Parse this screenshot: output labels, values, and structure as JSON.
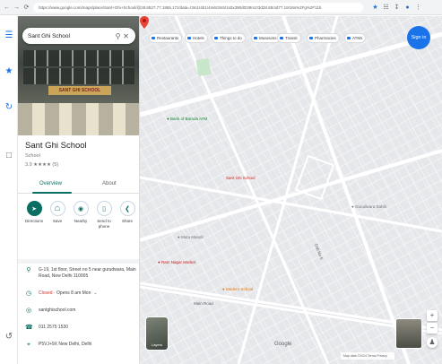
{
  "browser": {
    "url": "https://www.google.com/maps/place/Sant+Ghi+School/@28.6527,77.1955,17z/data=!3m1!4b1!4m6!3m5!1s0x390d03!8m2!3d28.65!4d77.19!16s%2Fg%2F11b",
    "icons": [
      "back-icon",
      "forward-icon",
      "reload-icon",
      "bookmark-icon",
      "extensions-icon",
      "profile-icon",
      "menu-icon"
    ]
  },
  "search": {
    "query": "Sant Ghi School"
  },
  "place": {
    "hero_sign": "SANT GHI SCHOOL",
    "name": "Sant Ghi School",
    "category": "School",
    "rating_text": "3.9 ★★★★ (5)",
    "tabs": [
      {
        "label": "Overview"
      },
      {
        "label": "About"
      }
    ],
    "actions": [
      {
        "label": "Directions",
        "icon": "directions-icon"
      },
      {
        "label": "Save",
        "icon": "bookmark-icon"
      },
      {
        "label": "Nearby",
        "icon": "nearby-icon"
      },
      {
        "label": "Send to phone",
        "icon": "phone-icon"
      },
      {
        "label": "Share",
        "icon": "share-icon"
      }
    ],
    "info": {
      "address": "G-19, 1st floor, Street no 5 near gurudwara, Main Road, New Delhi 110005",
      "hours_status": "Closed",
      "hours_detail": " · Opens 8 am Mon",
      "website": "santghischool.com",
      "phone": "011 2575 1530",
      "plus_code": "P5VJ+9X New Delhi, Delhi"
    }
  },
  "map": {
    "filter_chips": [
      "Restaurants",
      "Hotels",
      "Things to do",
      "Museums",
      "Transit",
      "Pharmacies",
      "ATMs"
    ],
    "sign_in": "Sign in",
    "selected_label": "Sant Ghi School",
    "pois": [
      {
        "label": "Bank of Baroda ATM",
        "color": "#188038"
      },
      {
        "label": "Mata Mandir",
        "color": "#70757a"
      },
      {
        "label": "Ram Nagar Market",
        "color": "#c5221f"
      },
      {
        "label": "Modern School",
        "color": "#e37400"
      },
      {
        "label": "Gurudwara Sahib",
        "color": "#70757a"
      }
    ],
    "streets": [
      "Main Road",
      "Gali No 5"
    ],
    "layers_label": "Layers",
    "google_mark": "Google",
    "footer": "Map data ©2024 Terms Privacy"
  },
  "colors": {
    "accent": "#1a73e8",
    "teal": "#0b6e63",
    "pin": "#ea4335",
    "map_bg": "#e9eaec"
  }
}
